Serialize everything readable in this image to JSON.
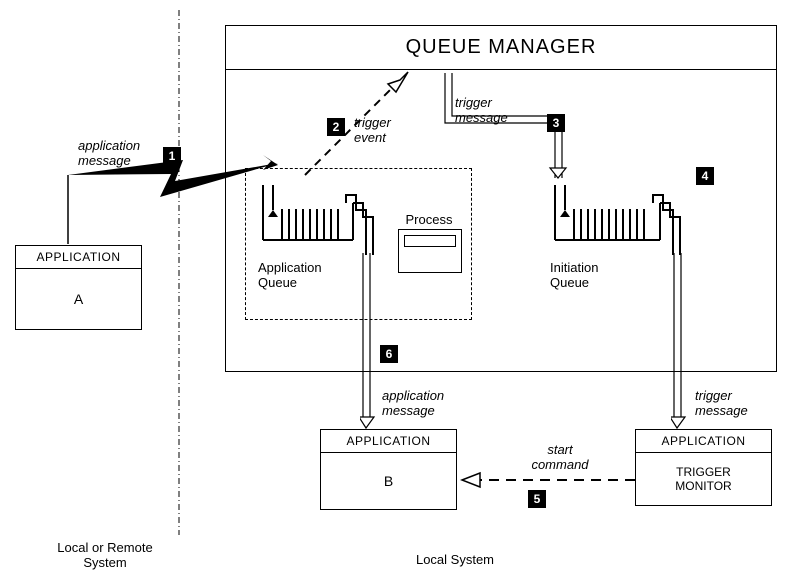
{
  "title": "QUEUE MANAGER",
  "regions": {
    "left": "Local or Remote\nSystem",
    "right": "Local System"
  },
  "apps": {
    "a": {
      "header": "APPLICATION",
      "name": "A"
    },
    "b": {
      "header": "APPLICATION",
      "name": "B"
    },
    "tm": {
      "header": "APPLICATION",
      "name": "TRIGGER\nMONITOR"
    }
  },
  "blocks": {
    "process": "Process",
    "app_queue": "Application\nQueue",
    "init_queue": "Initiation\nQueue"
  },
  "labels": {
    "application_message_top": "application\nmessage",
    "trigger_event": "trigger\nevent",
    "trigger_message": "trigger\nmessage",
    "application_message_bottom": "application\nmessage",
    "trigger_message_bottom": "trigger\nmessage",
    "start_command": "start\ncommand"
  },
  "steps": {
    "1": "1",
    "2": "2",
    "3": "3",
    "4": "4",
    "5": "5",
    "6": "6"
  },
  "chart_data": {
    "type": "diagram",
    "title": "Queue Manager triggering flow",
    "nodes": [
      {
        "id": "appA",
        "label": "APPLICATION A",
        "system": "Local or Remote System"
      },
      {
        "id": "qmgr",
        "label": "QUEUE MANAGER",
        "system": "Local System"
      },
      {
        "id": "app_queue",
        "label": "Application Queue",
        "parent": "qmgr"
      },
      {
        "id": "process",
        "label": "Process",
        "parent": "qmgr"
      },
      {
        "id": "init_queue",
        "label": "Initiation Queue",
        "parent": "qmgr"
      },
      {
        "id": "appB",
        "label": "APPLICATION B",
        "system": "Local System"
      },
      {
        "id": "trigger_monitor",
        "label": "APPLICATION TRIGGER MONITOR",
        "system": "Local System"
      }
    ],
    "edges": [
      {
        "step": 1,
        "from": "appA",
        "to": "app_queue",
        "label": "application message",
        "style": "solid-lightning"
      },
      {
        "step": 2,
        "from": "app_queue",
        "to": "qmgr",
        "label": "trigger event",
        "style": "dashed"
      },
      {
        "step": 3,
        "from": "qmgr",
        "to": "init_queue",
        "label": "trigger message",
        "style": "double"
      },
      {
        "step": 4,
        "from": "init_queue",
        "to": "trigger_monitor",
        "label": "trigger message",
        "style": "double"
      },
      {
        "step": 5,
        "from": "trigger_monitor",
        "to": "appB",
        "label": "start command",
        "style": "dashed"
      },
      {
        "step": 6,
        "from": "app_queue",
        "to": "appB",
        "label": "application message",
        "style": "double"
      }
    ]
  }
}
